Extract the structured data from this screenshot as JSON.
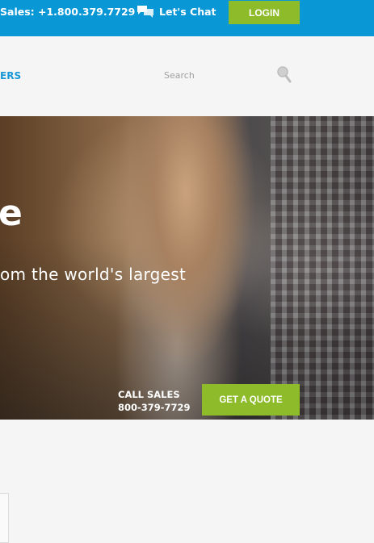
{
  "topbar": {
    "sales_text": "Sales: +1.800.379.7729",
    "chat_label": "Let's Chat",
    "login_label": "LOGIN",
    "background": "#0a97d6",
    "accent": "#8dbb2a"
  },
  "nav": {
    "partial_link": "ERS",
    "search_placeholder": "Search",
    "search_icon": "search-icon"
  },
  "hero": {
    "headline_fragment": "e",
    "subtitle_fragment": "om the world's largest",
    "call_sales_label": "CALL SALES",
    "call_sales_number": "800-379-7729",
    "quote_button": "GET A QUOTE"
  }
}
